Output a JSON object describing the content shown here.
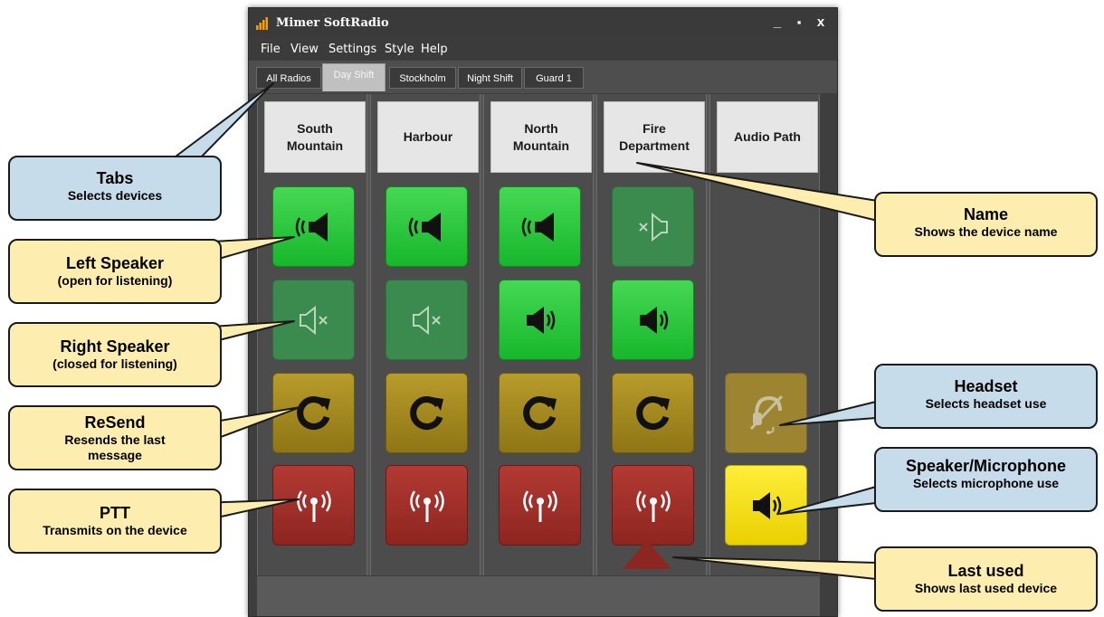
{
  "window": {
    "title": "Mimer SoftRadio",
    "controls": {
      "minimize": "_",
      "maximize": "▪",
      "close": "x"
    }
  },
  "menu": [
    "File",
    "View",
    "Settings",
    "Style",
    "Help"
  ],
  "tabs": [
    {
      "label": "All Radios",
      "active": false
    },
    {
      "label": "Day Shift",
      "active": true
    },
    {
      "label": "Stockholm",
      "active": false
    },
    {
      "label": "Night Shift",
      "active": false
    },
    {
      "label": "Guard 1",
      "active": false
    }
  ],
  "devices": [
    {
      "name": "South\nMountain",
      "left_speaker": "open",
      "right_speaker": "closed"
    },
    {
      "name": "Harbour",
      "left_speaker": "open",
      "right_speaker": "closed"
    },
    {
      "name": "North\nMountain",
      "left_speaker": "open",
      "right_speaker": "open"
    },
    {
      "name": "Fire\nDepartment",
      "left_speaker": "closed",
      "right_speaker": "open"
    }
  ],
  "audio_path": {
    "name": "Audio Path"
  },
  "colors": {
    "speaker_open": "#1fbf33",
    "speaker_closed": "#3c8b4e",
    "resend": "#a38a20",
    "ptt": "#9e2f29",
    "speaker_mic": "#f5de10",
    "last_used": "#8b2621",
    "callout_blue": "#c6dcea",
    "callout_cream": "#fdeeb0"
  },
  "icons": {
    "left_speaker": "speaker-left-icon",
    "right_speaker": "speaker-right-icon",
    "muted": "speaker-muted-icon",
    "resend": "refresh-icon",
    "ptt": "antenna-icon",
    "headset": "headset-crossed-icon",
    "speaker_mic": "speaker-icon"
  },
  "callouts": {
    "tabs": {
      "title": "Tabs",
      "sub": "Selects devices"
    },
    "left_speaker": {
      "title": "Left Speaker",
      "sub": "(open for listening)"
    },
    "right_speaker": {
      "title": "Right Speaker",
      "sub": "(closed for listening)"
    },
    "resend": {
      "title": "ReSend",
      "sub": "Resends the last message"
    },
    "ptt": {
      "title": "PTT",
      "sub": "Transmits on the device"
    },
    "name": {
      "title": "Name",
      "sub": "Shows the device name"
    },
    "headset": {
      "title": "Headset",
      "sub": "Selects headset use"
    },
    "speaker_mic": {
      "title": "Speaker/Microphone",
      "sub": "Selects microphone use"
    },
    "last_used": {
      "title": "Last used",
      "sub": "Shows last used device"
    }
  }
}
